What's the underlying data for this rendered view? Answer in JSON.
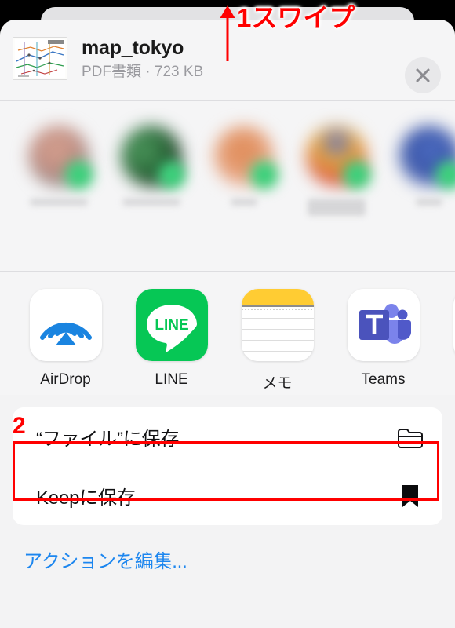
{
  "sheet": {
    "file": {
      "name": "map_tokyo",
      "subtitle": "PDF書類 · 723 KB",
      "thumbnail_icon": "tokyo-rail-map-thumbnail",
      "close_icon": "close-x-icon"
    },
    "contacts": [
      {
        "badge_icon": "line-app-badge",
        "avatar_color": "#c89a8c",
        "name_blurred": true
      },
      {
        "badge_icon": "line-app-badge",
        "avatar_color": "#2e4a33",
        "name_blurred": true
      },
      {
        "badge_icon": "line-app-badge",
        "avatar_color": "#e0a080",
        "name_blurred": true
      },
      {
        "badge_icon": "line-app-badge",
        "avatar_color": "#e8a83c",
        "name_blurred": true
      },
      {
        "badge_icon": "line-app-badge",
        "avatar_color": "#5570c0",
        "name_blurred": true
      }
    ],
    "apps": [
      {
        "label": "AirDrop",
        "icon": "airdrop-icon"
      },
      {
        "label": "LINE",
        "icon": "line-icon"
      },
      {
        "label": "メモ",
        "icon": "notes-icon"
      },
      {
        "label": "Teams",
        "icon": "teams-icon"
      },
      {
        "label": "",
        "icon": "gmail-icon"
      }
    ],
    "actions": [
      {
        "label": "“ファイル”に保存",
        "icon": "folder-icon"
      },
      {
        "label": "Keepに保存",
        "icon": "bookmark-icon"
      }
    ],
    "edit_actions_label": "アクションを編集..."
  },
  "annotations": {
    "step1_label": "1スワイプ",
    "step1_icon": "up-arrow-icon",
    "step2_label": "2",
    "highlight_color": "#ff0000"
  },
  "colors": {
    "accent_blue": "#1c86ef",
    "sheet_bg": "#f5f5f6",
    "card_bg": "#ffffff",
    "annotation_red": "#ff0000",
    "line_green": "#06c755",
    "notes_yellow": "#ffcc33",
    "teams_purple": "#5b5fc7"
  }
}
